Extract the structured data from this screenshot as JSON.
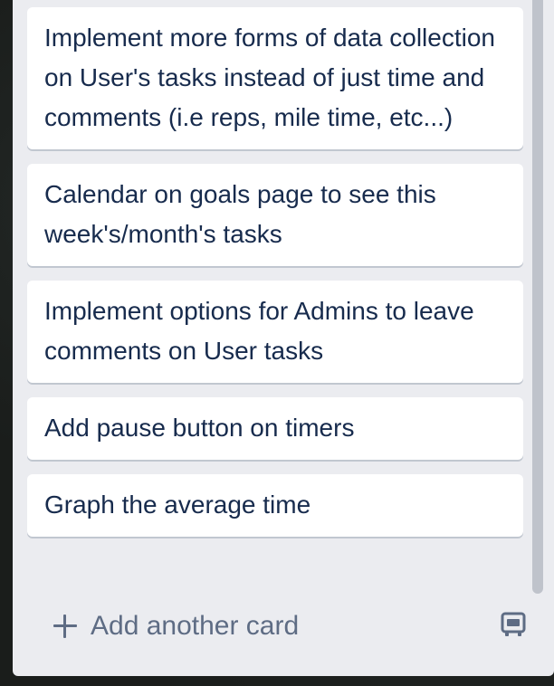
{
  "cards": [
    {
      "title": "Implement more forms of data collection on User's tasks instead of just time and comments (i.e reps, mile time, etc...)"
    },
    {
      "title": "Calendar on goals page to see this week's/month's tasks"
    },
    {
      "title": "Implement options for Admins to leave comments on User tasks"
    },
    {
      "title": "Add pause button on timers"
    },
    {
      "title": "Graph the average time"
    }
  ],
  "composer": {
    "add_label": "Add another card",
    "add_icon": "plus-icon",
    "template_icon": "card-template-icon"
  },
  "colors": {
    "list_bg": "#ebecf0",
    "card_bg": "#ffffff",
    "text": "#172b4d",
    "muted": "#5e6c84"
  }
}
